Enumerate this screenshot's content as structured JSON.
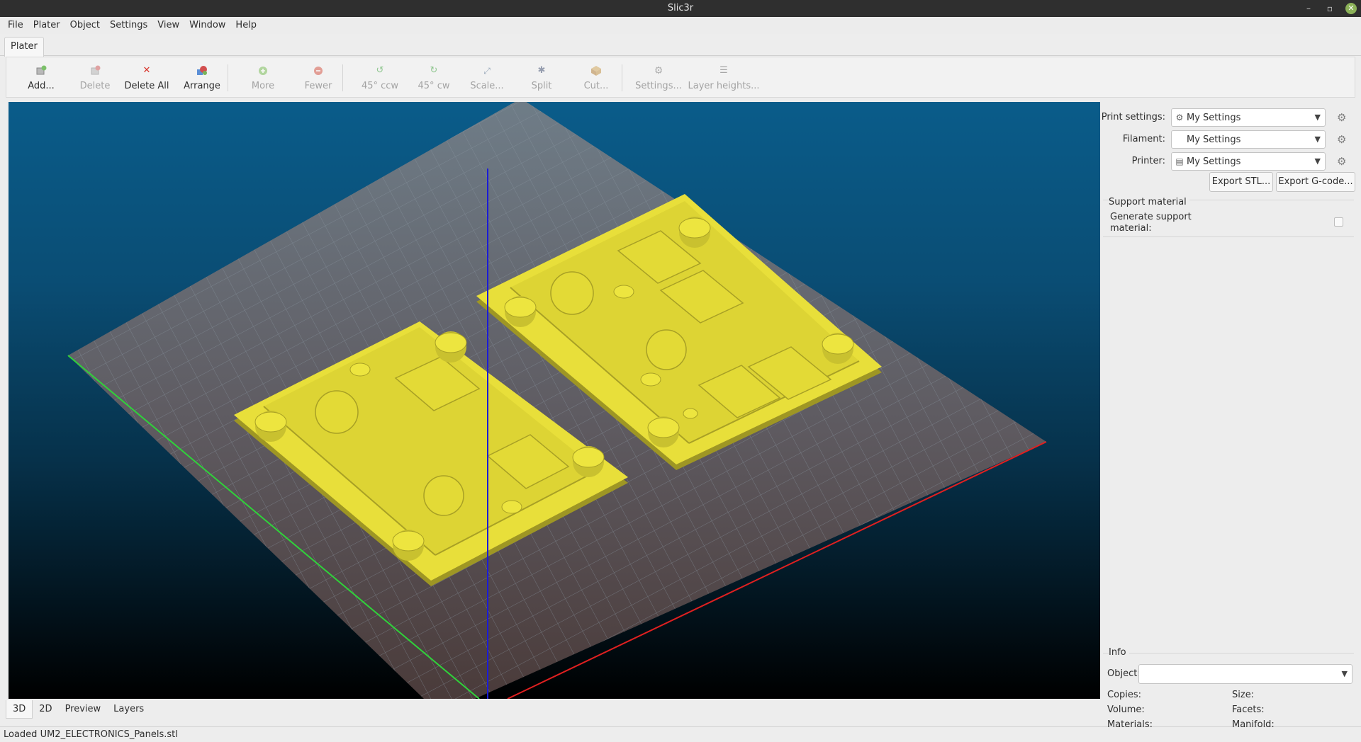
{
  "window": {
    "title": "Slic3r",
    "minimize": "–",
    "restore": "▫",
    "close": "✕"
  },
  "menu": [
    "File",
    "Plater",
    "Object",
    "Settings",
    "View",
    "Window",
    "Help"
  ],
  "tab": {
    "label": "Plater"
  },
  "toolbar": {
    "add": "Add...",
    "delete": "Delete",
    "delete_all": "Delete All",
    "arrange": "Arrange",
    "more": "More",
    "fewer": "Fewer",
    "rotate_ccw": "45° ccw",
    "rotate_cw": "45° cw",
    "scale": "Scale...",
    "split": "Split",
    "cut": "Cut...",
    "settings": "Settings...",
    "layer_heights": "Layer heights..."
  },
  "right_panel": {
    "print_settings_label": "Print settings:",
    "print_settings_value": "My Settings",
    "filament_label": "Filament:",
    "filament_value": "My Settings",
    "printer_label": "Printer:",
    "printer_value": "My Settings",
    "export_stl": "Export STL...",
    "export_gcode": "Export G-code...",
    "support_group": "Support material",
    "generate_support": "Generate support material:",
    "generate_support_checked": false
  },
  "info": {
    "title": "Info",
    "object_label": "Object:",
    "copies": "Copies:",
    "size": "Size:",
    "volume": "Volume:",
    "facets": "Facets:",
    "materials": "Materials:",
    "manifold": "Manifold:"
  },
  "view_tabs": [
    "3D",
    "2D",
    "Preview",
    "Layers"
  ],
  "active_view_tab": "3D",
  "status": {
    "text": "Loaded UM2_ELECTRONICS_Panels.stl"
  },
  "scene": {
    "object_color": "#e8df3a",
    "object_shade": "#c6bf2e",
    "bed_color": "#5f6f7c",
    "x_axis_color": "#e02020",
    "y_axis_color": "#2fd23a",
    "z_axis_color": "#1b1bd8"
  }
}
